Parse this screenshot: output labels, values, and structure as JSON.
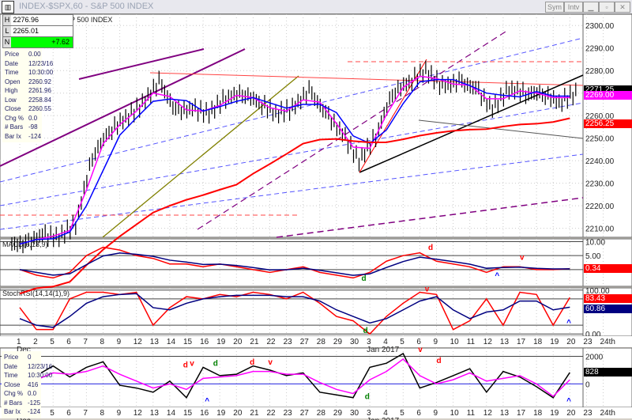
{
  "window": {
    "title": "INDEX-$SPX,60 - S&P 500 INDEX",
    "buttons": [
      "Sym",
      "Intv"
    ]
  },
  "hln": {
    "h_label": "H",
    "h": "2276.96",
    "l_label": "L",
    "l": "2265.01",
    "n_label": "N",
    "n": "+7.62",
    "n_color": "#00ff00"
  },
  "info_main": [
    [
      "Price",
      "0.00"
    ],
    [
      "Date",
      "12/23/16"
    ],
    [
      "Time",
      "10:30:00"
    ],
    [
      "Open",
      "2260.92"
    ],
    [
      "High",
      "2261.96"
    ],
    [
      "Low",
      "2258.84"
    ],
    [
      "Close",
      "2260.55"
    ],
    [
      "Chg %",
      "0.0"
    ],
    [
      "# Bars",
      "-98"
    ],
    [
      "Bar Ix",
      "-124"
    ]
  ],
  "info_bottom": [
    [
      "Price",
      "0"
    ],
    [
      "Date",
      "12/23/16"
    ],
    [
      "Time",
      "10:30:00"
    ],
    [
      "Close",
      "416"
    ],
    [
      "Chg %",
      "0.0"
    ],
    [
      "# Bars",
      "-125"
    ],
    [
      "Bar Ix",
      "-124"
    ]
  ],
  "chart_data": [
    {
      "type": "bar",
      "title": "INDEX-$SPX,60 - S&P 500 INDEX",
      "x_labels": [
        "1",
        "2",
        "5",
        "6",
        "7",
        "8",
        "9",
        "12",
        "13",
        "14",
        "15",
        "16",
        "19",
        "20",
        "21",
        "22",
        "23",
        "27",
        "28",
        "29",
        "30",
        "3",
        "4",
        "5",
        "6",
        "9",
        "10",
        "11",
        "12",
        "13",
        "17",
        "18",
        "19",
        "20",
        "23",
        "24th"
      ],
      "month_labels": {
        "0": "Dec",
        "21": "Jan 2017"
      },
      "closes": [
        2203,
        2207,
        2206,
        2212,
        2242,
        2253,
        2259,
        2265,
        2275,
        2262,
        2263,
        2261,
        2268,
        2270,
        2266,
        2261,
        2263,
        2271,
        2261,
        2252,
        2240,
        2251,
        2270,
        2275,
        2280,
        2273,
        2275,
        2272,
        2263,
        2272,
        2270,
        2270,
        2266,
        2270
      ],
      "y_ticks": [
        2300,
        2290,
        2280,
        2270,
        2260,
        2250,
        2240,
        2230,
        2220,
        2210
      ],
      "ylim": [
        2206,
        2305
      ],
      "tags": [
        {
          "value": "2271.25",
          "color": "#000000"
        },
        {
          "value": "2269.00",
          "color": "#ff00ff"
        },
        {
          "value": "2256.25",
          "color": "#ff0000"
        }
      ],
      "colors": {
        "bars": "#000000",
        "ma_fast": "#ff00ff",
        "ma_mid": "#0000ff",
        "ma_slow": "#ff0000"
      }
    },
    {
      "type": "line",
      "title": "MACD(6,13,9)",
      "y_ticks": [
        "10.00",
        "5.00"
      ],
      "ylim": [
        -6,
        11
      ],
      "macd": [
        0,
        -2,
        -3,
        -1,
        5,
        8,
        7,
        5,
        4,
        2,
        2,
        1,
        2,
        1,
        0,
        -1,
        0,
        1,
        -1,
        -2,
        -3,
        -1,
        3,
        5,
        6,
        3,
        2,
        1,
        -1,
        1,
        1,
        0,
        0,
        0.3
      ],
      "tag": "0.34",
      "annotations": [
        {
          "text": "d",
          "i": 20.5,
          "v": -4,
          "color": "#008000"
        },
        {
          "text": "d",
          "i": 24.5,
          "v": 7,
          "color": "#ff0000"
        },
        {
          "text": "v",
          "i": 30,
          "v": 3.5,
          "color": "#ff0000"
        },
        {
          "text": "^",
          "i": 28.5,
          "v": -3,
          "color": "#0000ff"
        }
      ]
    },
    {
      "type": "line",
      "title": "StochRSI(14,14(1),9)",
      "y_ticks": [
        "100.00",
        "0.00"
      ],
      "ylim": [
        -5,
        105
      ],
      "k": [
        60,
        10,
        10,
        80,
        95,
        95,
        90,
        95,
        20,
        60,
        85,
        80,
        90,
        85,
        95,
        90,
        80,
        95,
        70,
        40,
        30,
        0,
        40,
        70,
        95,
        90,
        10,
        30,
        80,
        20,
        95,
        90,
        20,
        83
      ],
      "d": [
        35,
        20,
        15,
        40,
        70,
        85,
        90,
        92,
        60,
        55,
        70,
        80,
        85,
        88,
        88,
        88,
        85,
        85,
        75,
        55,
        40,
        25,
        35,
        55,
        75,
        85,
        55,
        35,
        50,
        55,
        75,
        75,
        55,
        61
      ],
      "tags": [
        {
          "value": "83.43",
          "color": "#ff0000"
        },
        {
          "value": "60.86",
          "color": "#000080"
        }
      ],
      "annotations": [
        {
          "text": "d",
          "i": 20.6,
          "v": 2,
          "color": "#008000"
        },
        {
          "text": "v",
          "i": 24.3,
          "v": 97,
          "color": "#ff0000"
        },
        {
          "text": "^",
          "i": 32.8,
          "v": 20,
          "color": "#0000ff"
        }
      ]
    },
    {
      "type": "line",
      "y_ticks": [
        "2000",
        "0"
      ],
      "ylim": [
        -1700,
        2600
      ],
      "line": [
        -200,
        600,
        1300,
        500,
        1200,
        1600,
        -100,
        -300,
        -600,
        200,
        -1000,
        1200,
        600,
        700,
        1300,
        1000,
        600,
        800,
        -600,
        -800,
        -1000,
        1200,
        1500,
        2200,
        -300,
        100,
        600,
        1100,
        -600,
        900,
        500,
        -200,
        -1000,
        828
      ],
      "signal": [
        0,
        300,
        800,
        700,
        900,
        1300,
        700,
        200,
        -300,
        0,
        -400,
        400,
        500,
        600,
        900,
        900,
        700,
        700,
        100,
        -400,
        -700,
        300,
        900,
        1800,
        600,
        0,
        300,
        800,
        200,
        400,
        600,
        0,
        -900,
        300
      ],
      "tag": "828",
      "annotations": [
        {
          "text": "d",
          "i": 9.8,
          "v": 1200,
          "color": "#ff0000"
        },
        {
          "text": "v",
          "i": 10.2,
          "v": 1300,
          "color": "#ff0000"
        },
        {
          "text": "d",
          "i": 11.6,
          "v": 1300,
          "color": "#008000"
        },
        {
          "text": "d",
          "i": 13.8,
          "v": 1400,
          "color": "#ff0000"
        },
        {
          "text": "v",
          "i": 14.9,
          "v": 1400,
          "color": "#ff0000"
        },
        {
          "text": "^",
          "i": 11.1,
          "v": -1400,
          "color": "#0000ff"
        },
        {
          "text": "d",
          "i": 20.7,
          "v": -1100,
          "color": "#008000"
        },
        {
          "text": "v",
          "i": 23.9,
          "v": 2300,
          "color": "#ff0000"
        },
        {
          "text": "d",
          "i": 25,
          "v": 1500,
          "color": "#ff0000"
        },
        {
          "text": "^",
          "i": 32.8,
          "v": -1400,
          "color": "#0000ff"
        }
      ]
    }
  ]
}
